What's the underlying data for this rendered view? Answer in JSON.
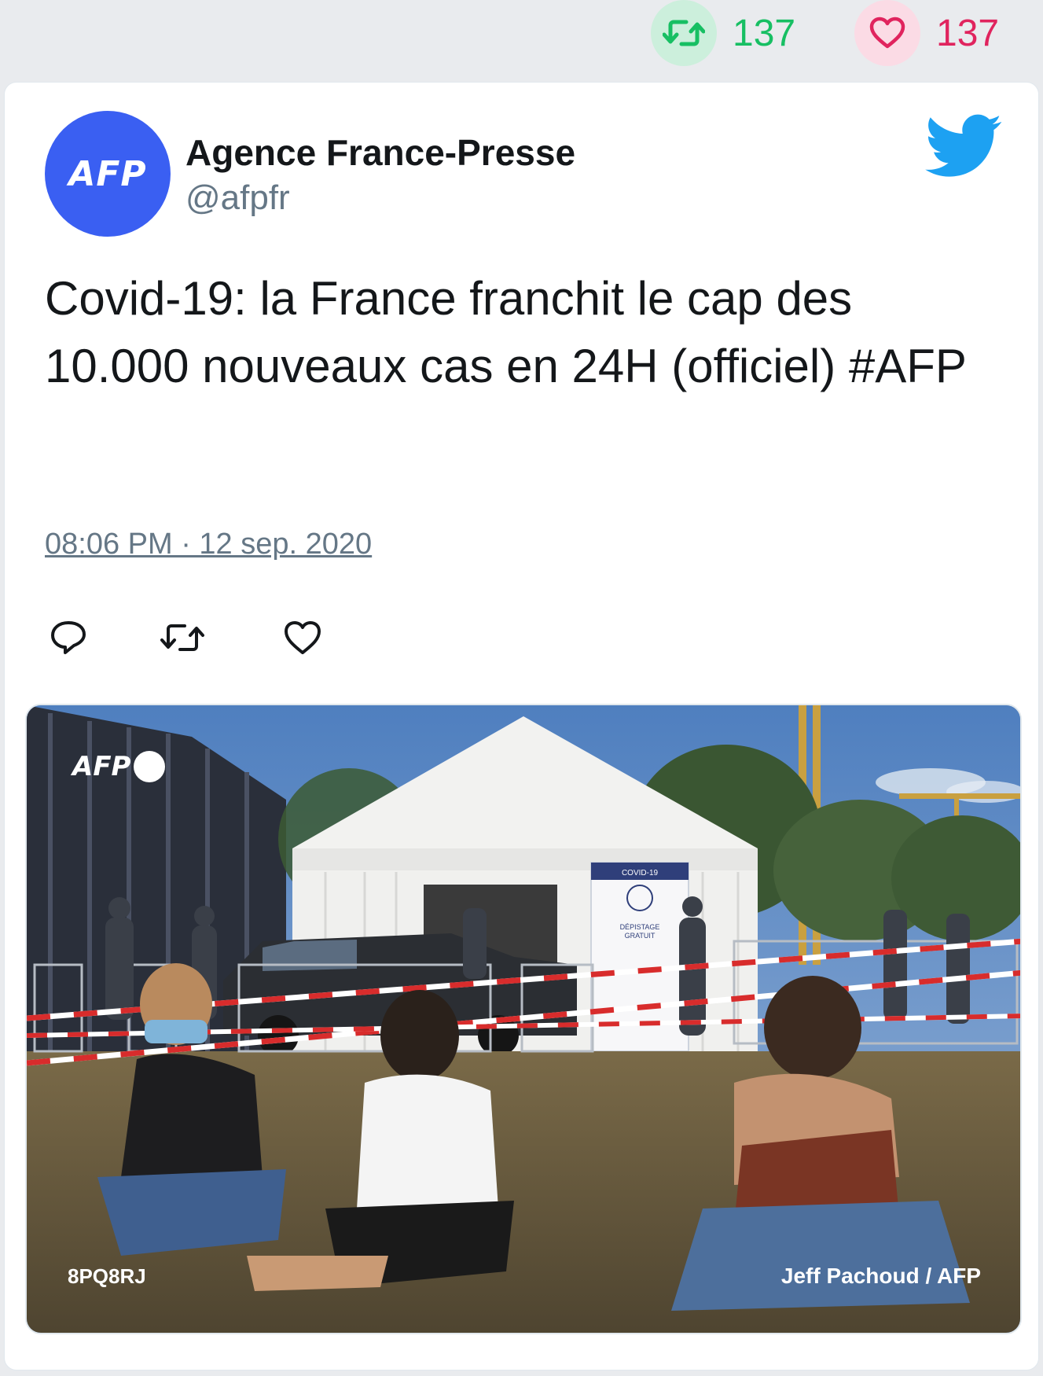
{
  "top_stats": {
    "retweets": "137",
    "likes": "137",
    "retweet_color": "#17bf63",
    "like_color": "#e0245e"
  },
  "tweet": {
    "avatar_text": "AFP",
    "author_name": "Agence France-Presse",
    "author_handle": "@afpfr",
    "text": "Covid-19: la France franchit le cap des 10.000 nouveaux cas en 24H (officiel) #AFP",
    "timestamp": "08:06 PM · 12 sep. 2020",
    "brand_icon": "twitter-bird-icon",
    "action_icons": [
      "reply-icon",
      "retweet-icon",
      "like-icon"
    ]
  },
  "photo": {
    "logo_text": "AFP",
    "photo_id": "8PQ8RJ",
    "credit": "Jeff Pachoud / AFP",
    "sign_title": "COVID-19",
    "sign_text": "DÉPISTAGE GRATUIT"
  }
}
